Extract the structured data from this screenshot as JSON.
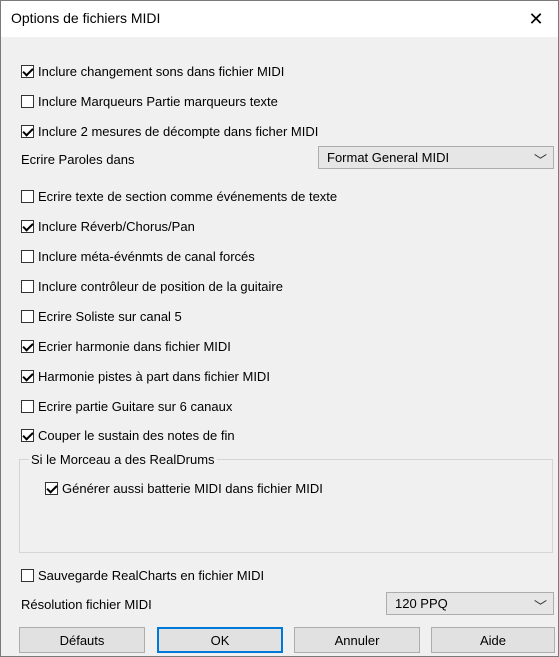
{
  "window": {
    "title": "Options de fichiers MIDI",
    "close_glyph": "✕"
  },
  "options": [
    {
      "label": "Inclure changement sons dans fichier MIDI",
      "checked": true
    },
    {
      "label": "Inclure Marqueurs Partie marqueurs texte",
      "checked": false
    },
    {
      "label": "Inclure 2 mesures de décompte dans ficher MIDI",
      "checked": true
    },
    {
      "label": "Ecrire texte de section comme événements de texte",
      "checked": false
    },
    {
      "label": "Inclure Réverb/Chorus/Pan",
      "checked": true
    },
    {
      "label": "Inclure méta-événmts de canal forcés",
      "checked": false
    },
    {
      "label": "Inclure contrôleur de position de la guitaire",
      "checked": false
    },
    {
      "label": "Ecrire Soliste sur canal 5",
      "checked": false
    },
    {
      "label": "Ecrier harmonie dans fichier MIDI",
      "checked": true
    },
    {
      "label": "Harmonie pistes à part dans fichier MIDI",
      "checked": true
    },
    {
      "label": "Ecrire partie Guitare sur 6 canaux",
      "checked": false
    },
    {
      "label": "Couper le sustain des notes de fin",
      "checked": true
    }
  ],
  "lyrics": {
    "label": "Ecrire Paroles dans",
    "value": "Format General MIDI"
  },
  "realdrums_group": {
    "title": "Si le Morceau a des RealDrums",
    "option": {
      "label": "Générer aussi batterie MIDI dans fichier MIDI",
      "checked": true
    }
  },
  "save_realcharts": {
    "label": "Sauvegarde RealCharts en fichier MIDI",
    "checked": false
  },
  "resolution": {
    "label": "Résolution fichier MIDI",
    "value": "120 PPQ"
  },
  "buttons": {
    "defaults": "Défauts",
    "ok": "OK",
    "cancel": "Annuler",
    "help": "Aide"
  },
  "icons": {
    "dropdown": "chevron-down-icon",
    "close": "close-icon"
  }
}
